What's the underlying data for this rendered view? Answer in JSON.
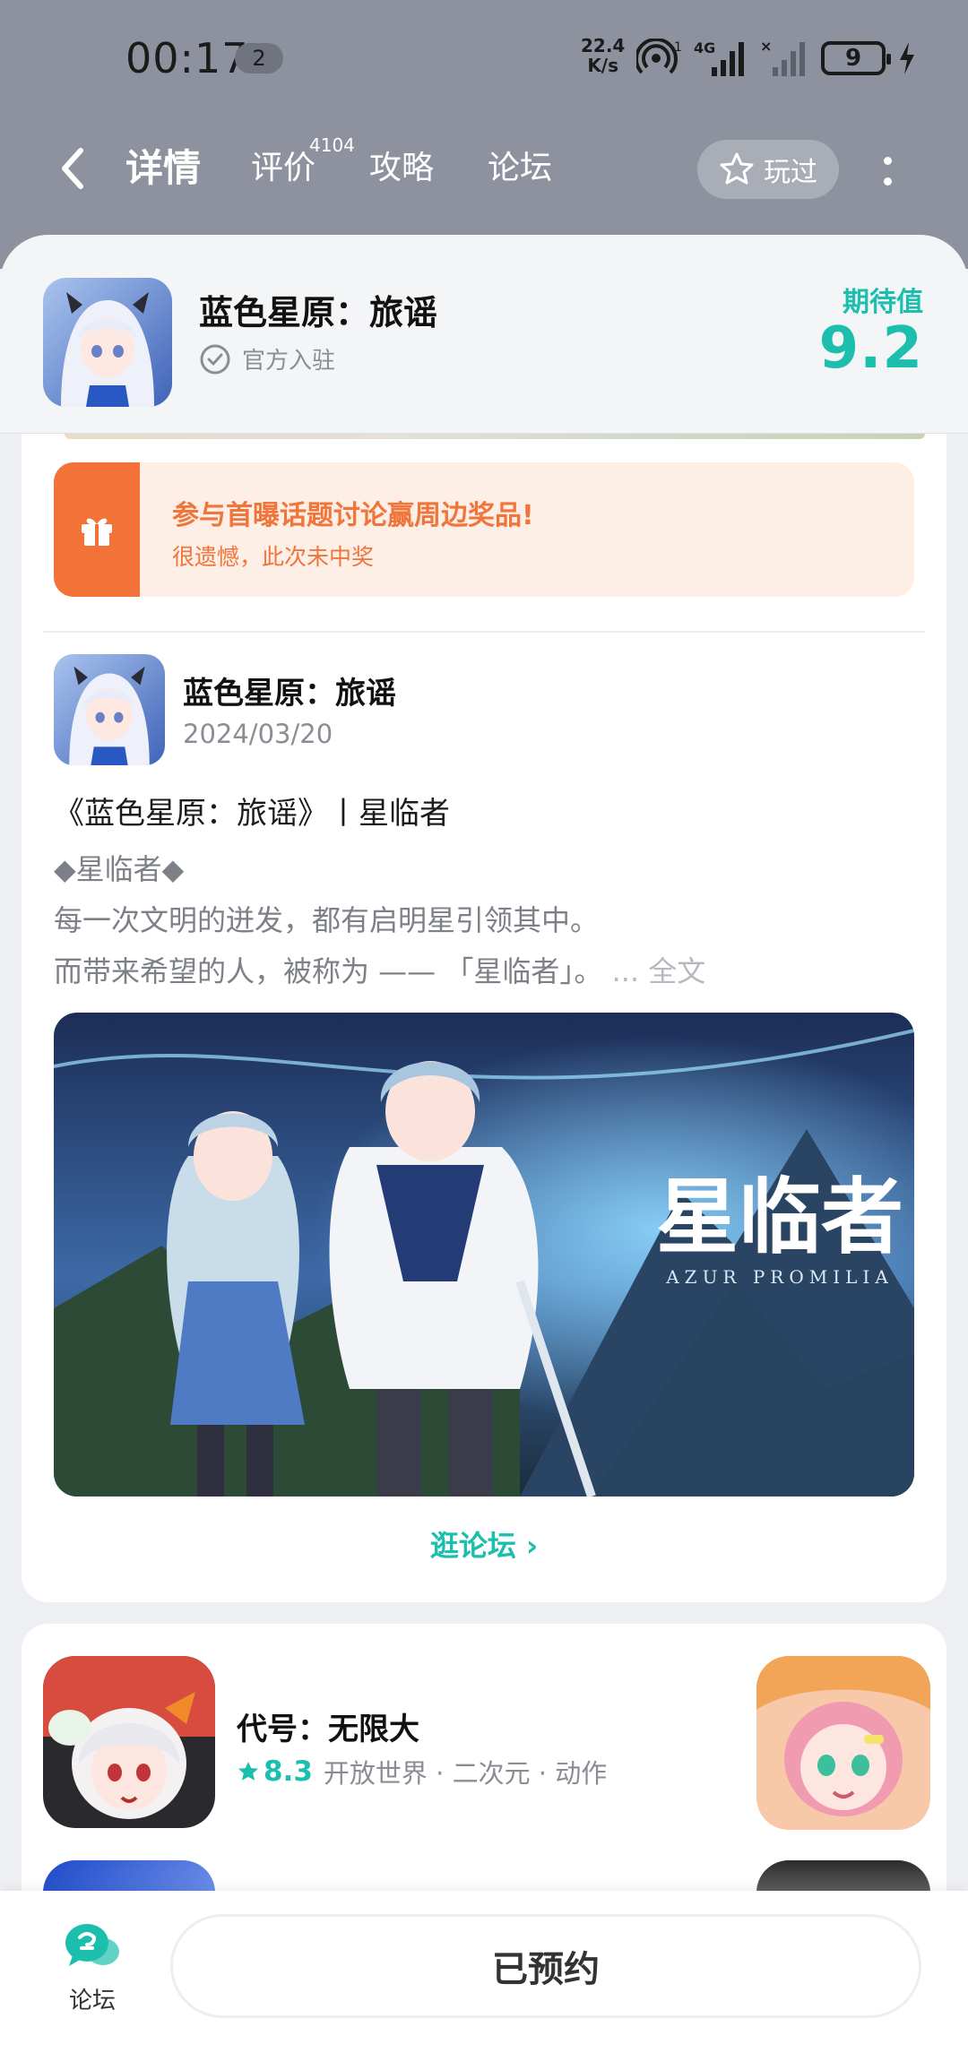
{
  "status_bar": {
    "time": "00:17",
    "notification_count": "2",
    "net_speed_value": "22.4",
    "net_speed_unit": "K/s",
    "network_type": "4G",
    "battery": "9"
  },
  "nav": {
    "tabs": [
      {
        "label": "详情",
        "active": true
      },
      {
        "label": "评价",
        "count": "4104"
      },
      {
        "label": "攻略"
      },
      {
        "label": "论坛"
      }
    ],
    "played_label": "玩过"
  },
  "game": {
    "title": "蓝色星原：旅谣",
    "official_label": "官方入驻",
    "expect_label": "期待值",
    "expect_value": "9.2"
  },
  "promo": {
    "title": "参与首曝话题讨论赢周边奖品!",
    "subtitle": "很遗憾，此次未中奖"
  },
  "post": {
    "author": "蓝色星原：旅谣",
    "date": "2024/03/20",
    "title": "《蓝色星原：旅谣》丨星临者",
    "line1": "◆星临者◆",
    "line2": "每一次文明的迸发，都有启明星引领其中。",
    "line3": "而带来希望的人，被称为 —— 「星临者」。",
    "ellipsis": "...",
    "full_text_label": "全文",
    "banner_title": "星临者",
    "banner_subtitle": "AZUR PROMILIA"
  },
  "forum_link_label": "逛论坛",
  "recommendation": {
    "name": "代号：无限大",
    "score": "8.3",
    "tags": "开放世界 · 二次元 · 动作"
  },
  "bottom_bar": {
    "forum_label": "论坛",
    "reserved_label": "已预约"
  },
  "colors": {
    "accent": "#1cbfae",
    "header_grey": "#8d929e",
    "promo_orange": "#f37237",
    "promo_bg": "#fdeee6"
  }
}
